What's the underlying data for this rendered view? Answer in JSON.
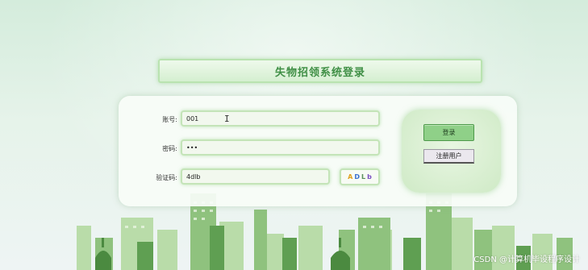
{
  "page": {
    "title": "失物招领系统登录"
  },
  "form": {
    "account": {
      "label": "账号:",
      "value": "001"
    },
    "password": {
      "label": "密码:",
      "value": "•••"
    },
    "captcha": {
      "label": "验证码:",
      "value": "4dlb",
      "chars": [
        "A",
        "D",
        "L",
        "b"
      ]
    }
  },
  "buttons": {
    "login": "登录",
    "register": "注册用户"
  },
  "watermark": "CSDN @计算机毕设程序设计",
  "colors": {
    "title_text": "#3f8f45",
    "login_button": "#8fd088",
    "field_border": "#c4e4b8",
    "captcha_chars": [
      "#e0a020",
      "#3a6fd0",
      "#5a8f5a",
      "#7a4fc0"
    ]
  }
}
